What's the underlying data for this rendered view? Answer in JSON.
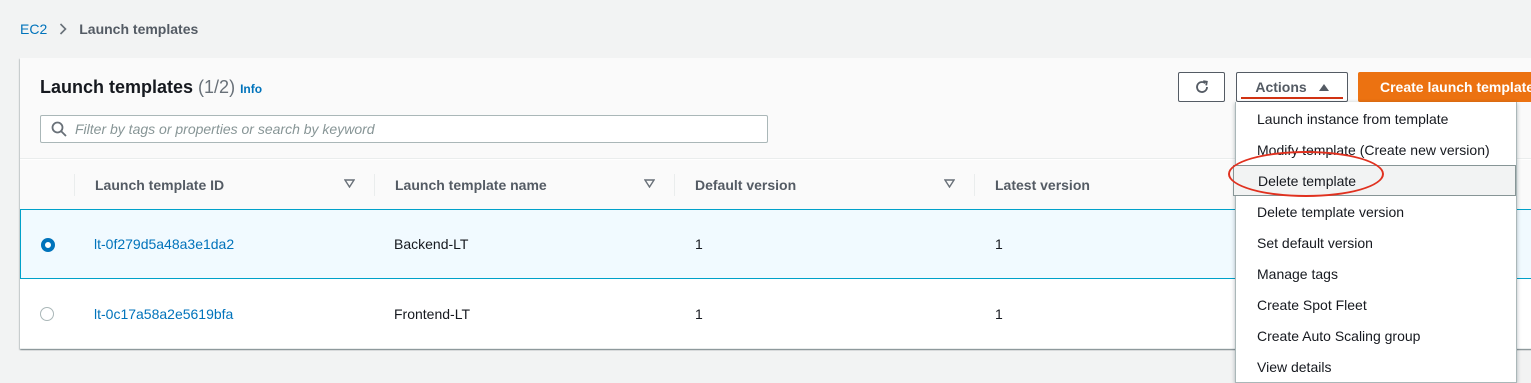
{
  "breadcrumb": {
    "root": "EC2",
    "current": "Launch templates"
  },
  "header": {
    "title": "Launch templates",
    "count": "(1/2)",
    "info": "Info",
    "actions_label": "Actions",
    "create_label": "Create launch template"
  },
  "search": {
    "placeholder": "Filter by tags or properties or search by keyword",
    "value": ""
  },
  "table": {
    "columns": [
      "Launch template ID",
      "Launch template name",
      "Default version",
      "Latest version"
    ],
    "rows": [
      {
        "id": "lt-0f279d5a48a3e1da2",
        "name": "Backend-LT",
        "default_version": "1",
        "latest_version": "1",
        "selected": true
      },
      {
        "id": "lt-0c17a58a2e5619bfa",
        "name": "Frontend-LT",
        "default_version": "1",
        "latest_version": "1",
        "selected": false
      }
    ]
  },
  "actions_menu": {
    "items": [
      "Launch instance from template",
      "Modify template (Create new version)",
      "Delete template",
      "Delete template version",
      "Set default version",
      "Manage tags",
      "Create Spot Fleet",
      "Create Auto Scaling group",
      "View details"
    ],
    "highlighted": "Delete template"
  },
  "colors": {
    "accent": "#0073bb",
    "primary_button": "#ec7211",
    "annotation": "#e0311f"
  },
  "icons": [
    "chevron-right-icon",
    "refresh-icon",
    "caret-up-icon",
    "search-icon",
    "sort-icon"
  ]
}
